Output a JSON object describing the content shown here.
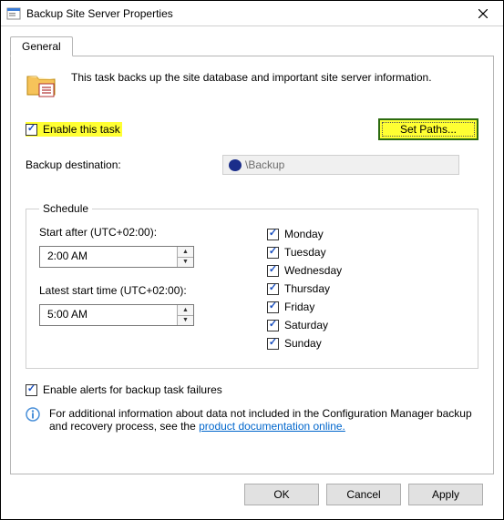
{
  "window": {
    "title": "Backup Site Server Properties"
  },
  "tabs": {
    "general": "General"
  },
  "intro": {
    "text": "This task backs up the site database and important site server information."
  },
  "enable": {
    "label": "Enable this task",
    "checked": true
  },
  "setpaths": {
    "label": "Set Paths..."
  },
  "destination": {
    "label": "Backup destination:",
    "value": "\\Backup"
  },
  "schedule": {
    "legend": "Schedule",
    "start_after_label": "Start after (UTC+02:00):",
    "start_after_value": "2:00 AM",
    "latest_label": "Latest start time (UTC+02:00):",
    "latest_value": "5:00 AM",
    "days": [
      {
        "label": "Monday",
        "checked": true
      },
      {
        "label": "Tuesday",
        "checked": true
      },
      {
        "label": "Wednesday",
        "checked": true
      },
      {
        "label": "Thursday",
        "checked": true
      },
      {
        "label": "Friday",
        "checked": true
      },
      {
        "label": "Saturday",
        "checked": true
      },
      {
        "label": "Sunday",
        "checked": true
      }
    ]
  },
  "alerts": {
    "label": "Enable alerts for backup task failures",
    "checked": true
  },
  "info": {
    "text_prefix": "For additional information about data not included in the Configuration Manager backup and recovery process, see the ",
    "link_text": "product documentation online."
  },
  "buttons": {
    "ok": "OK",
    "cancel": "Cancel",
    "apply": "Apply"
  }
}
